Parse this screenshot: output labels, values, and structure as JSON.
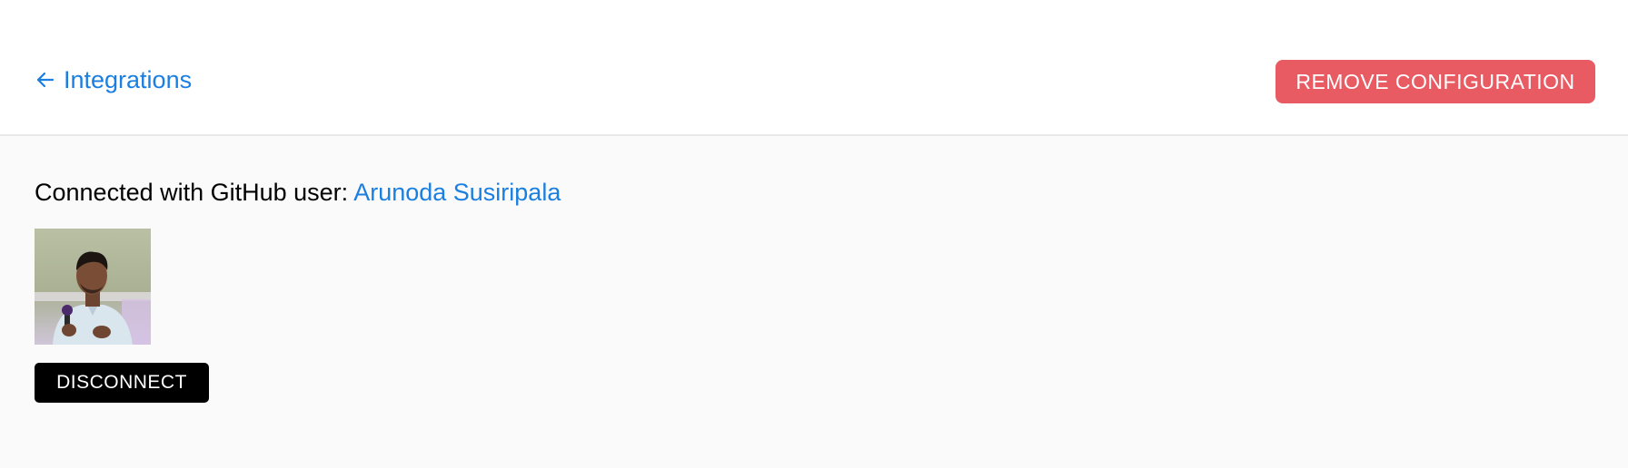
{
  "header": {
    "back_link_label": "Integrations",
    "back_icon": "arrow-left-icon",
    "remove_button_label": "REMOVE CONFIGURATION"
  },
  "main": {
    "connected_prefix": "Connected with GitHub user: ",
    "github_user_name": "Arunoda Susiripala",
    "avatar_icon": "user-avatar-photo",
    "disconnect_button_label": "DISCONNECT"
  },
  "colors": {
    "link": "#1a7fe0",
    "remove_button_bg": "#e95b63",
    "disconnect_button_bg": "#000000",
    "page_bg": "#fafafa",
    "header_bg": "#ffffff"
  }
}
